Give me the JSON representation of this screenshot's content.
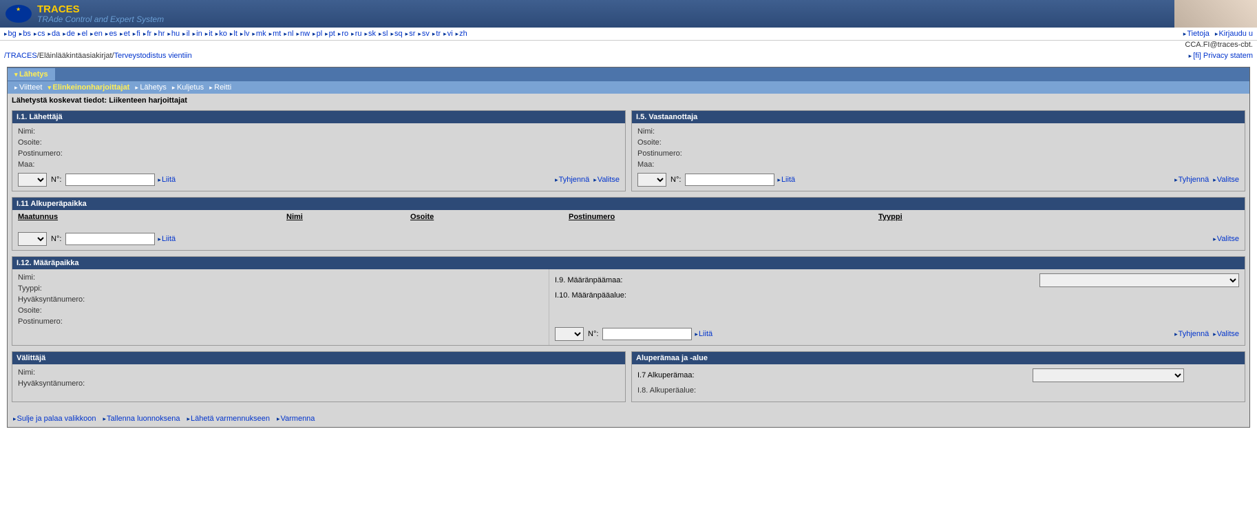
{
  "header": {
    "title": "TRACES",
    "subtitle": "TRAde Control and Expert System"
  },
  "languages": [
    "bg",
    "bs",
    "cs",
    "da",
    "de",
    "el",
    "en",
    "es",
    "et",
    "fi",
    "fr",
    "hr",
    "hu",
    "il",
    "in",
    "it",
    "ko",
    "lt",
    "lv",
    "mk",
    "mt",
    "nl",
    "nw",
    "pl",
    "pt",
    "ro",
    "ru",
    "sk",
    "sl",
    "sq",
    "sr",
    "sv",
    "tr",
    "vi",
    "zh"
  ],
  "top_links": {
    "info": "Tietoja",
    "login": "Kirjaudu u"
  },
  "user_line": "CCA.FI@traces-cbt.",
  "privacy": "[fi] Privacy statem",
  "breadcrumb": {
    "root": "/TRACES",
    "mid": "Eläinlääkintäasiakirjat",
    "leaf": "Terveystodistus vientiin"
  },
  "tabs1": {
    "lahetys": "Lähetys"
  },
  "tabs2": {
    "viitteet": "Viitteet",
    "elinkeinonharjoittajat": "Elinkeinonharjoittajat",
    "lahetys": "Lähetys",
    "kuljetus": "Kuljetus",
    "reitti": "Reitti"
  },
  "section_title": "Lähetystä koskevat tiedot: Liikenteen harjoittajat",
  "consignor": {
    "title": "I.1. Lähettäjä",
    "name": "Nimi:",
    "address": "Osoite:",
    "postal": "Postinumero:",
    "country": "Maa:",
    "no": "N°:",
    "assign": "Liitä",
    "clear": "Tyhjennä",
    "select": "Valitse"
  },
  "consignee": {
    "title": "I.5. Vastaanottaja",
    "name": "Nimi:",
    "address": "Osoite:",
    "postal": "Postinumero:",
    "country": "Maa:",
    "no": "N°:",
    "assign": "Liitä",
    "clear": "Tyhjennä",
    "select": "Valitse"
  },
  "origin": {
    "title": "I.11 Alkuperäpaikka",
    "cols": {
      "countrycode": "Maatunnus",
      "name": "Nimi",
      "address": "Osoite",
      "postal": "Postinumero",
      "type": "Tyyppi"
    },
    "no": "N°:",
    "assign": "Liitä",
    "select": "Valitse"
  },
  "destination": {
    "title": "I.12. Määräpaikka",
    "name": "Nimi:",
    "type": "Tyyppi:",
    "approval": "Hyväksyntänumero:",
    "address": "Osoite:",
    "postal": "Postinumero:",
    "dest_country": "I.9. Määränpäämaa:",
    "dest_region": "I.10. Määränpääalue:",
    "no": "N°:",
    "assign": "Liitä",
    "clear": "Tyhjennä",
    "select": "Valitse"
  },
  "agent": {
    "title": "Välittäjä",
    "name": "Nimi:",
    "approval": "Hyväksyntänumero:"
  },
  "origin_country": {
    "title": "Aluperämaa ja -alue",
    "country": "I.7 Alkuperämaa:",
    "region": "I.8. Alkuperäalue:"
  },
  "actions": {
    "close": "Sulje ja palaa valikkoon",
    "draft": "Tallenna luonnoksena",
    "submit": "Lähetä varmennukseen",
    "validate": "Varmenna"
  }
}
